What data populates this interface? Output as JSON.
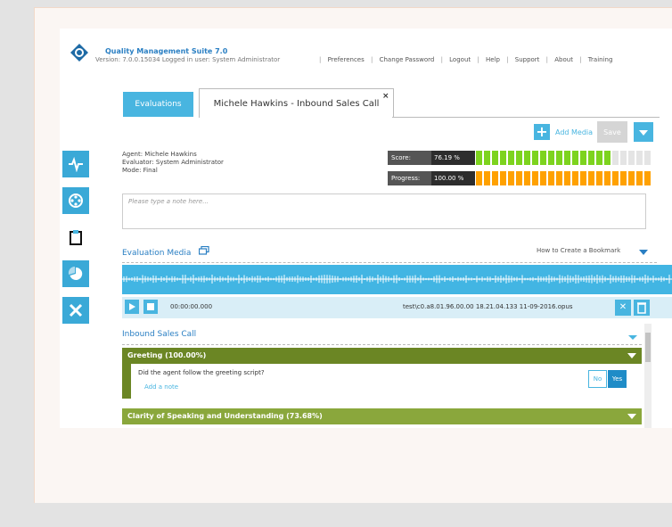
{
  "header": {
    "suite_title": "Quality Management Suite 7.0",
    "version_line": "Version: 7.0.0.15034   Logged in user: System Administrator",
    "nav": [
      "Preferences",
      "Change Password",
      "Logout",
      "Help",
      "Support",
      "About",
      "Training"
    ]
  },
  "sidebar": {
    "items": [
      {
        "icon": "pulse-icon",
        "active": true
      },
      {
        "icon": "film-reel-icon",
        "active": true
      },
      {
        "icon": "clipboard-icon",
        "active": false
      },
      {
        "icon": "pie-chart-icon",
        "active": true
      },
      {
        "icon": "tools-icon",
        "active": true
      }
    ]
  },
  "tabs": {
    "evaluations_label": "Evaluations",
    "call_label": "Michele Hawkins - Inbound Sales Call",
    "close_symbol": "×"
  },
  "toolbar": {
    "add_media_label": "Add Media",
    "save_label": "Save"
  },
  "details": {
    "agent": "Agent: Michele Hawkins",
    "evaluator": "Evaluator: System Administrator",
    "mode": "Mode: Final"
  },
  "metrics": {
    "score_label": "Score:",
    "score_value": "76.19 %",
    "score_fraction": 0.7619,
    "progress_label": "Progress:",
    "progress_value": "100.00 %",
    "progress_fraction": 1.0,
    "score_color": "#7dd31e",
    "progress_color": "#ffa100",
    "empty_color": "#e4e4e4",
    "segments": 22
  },
  "note": {
    "placeholder": "Please type a note here..."
  },
  "media": {
    "title": "Evaluation Media",
    "bookmark_label": "How to Create a Bookmark",
    "time": "00:00:00.000",
    "filename": "test\\c0.a8.01.96.00.00 18.21.04.133 11-09-2016.opus"
  },
  "form": {
    "title": "Inbound Sales Call",
    "sections": [
      {
        "label": "Greeting (100.00%)",
        "color": "#6b8624"
      },
      {
        "label": "Clarity of Speaking and Understanding (73.68%)",
        "color": "#8aa73c"
      }
    ],
    "question": "Did the agent follow the greeting script?",
    "add_note": "Add a note",
    "no_label": "No",
    "yes_label": "Yes"
  },
  "colors": {
    "accent": "#48b5e0",
    "link": "#2a7fc3"
  }
}
